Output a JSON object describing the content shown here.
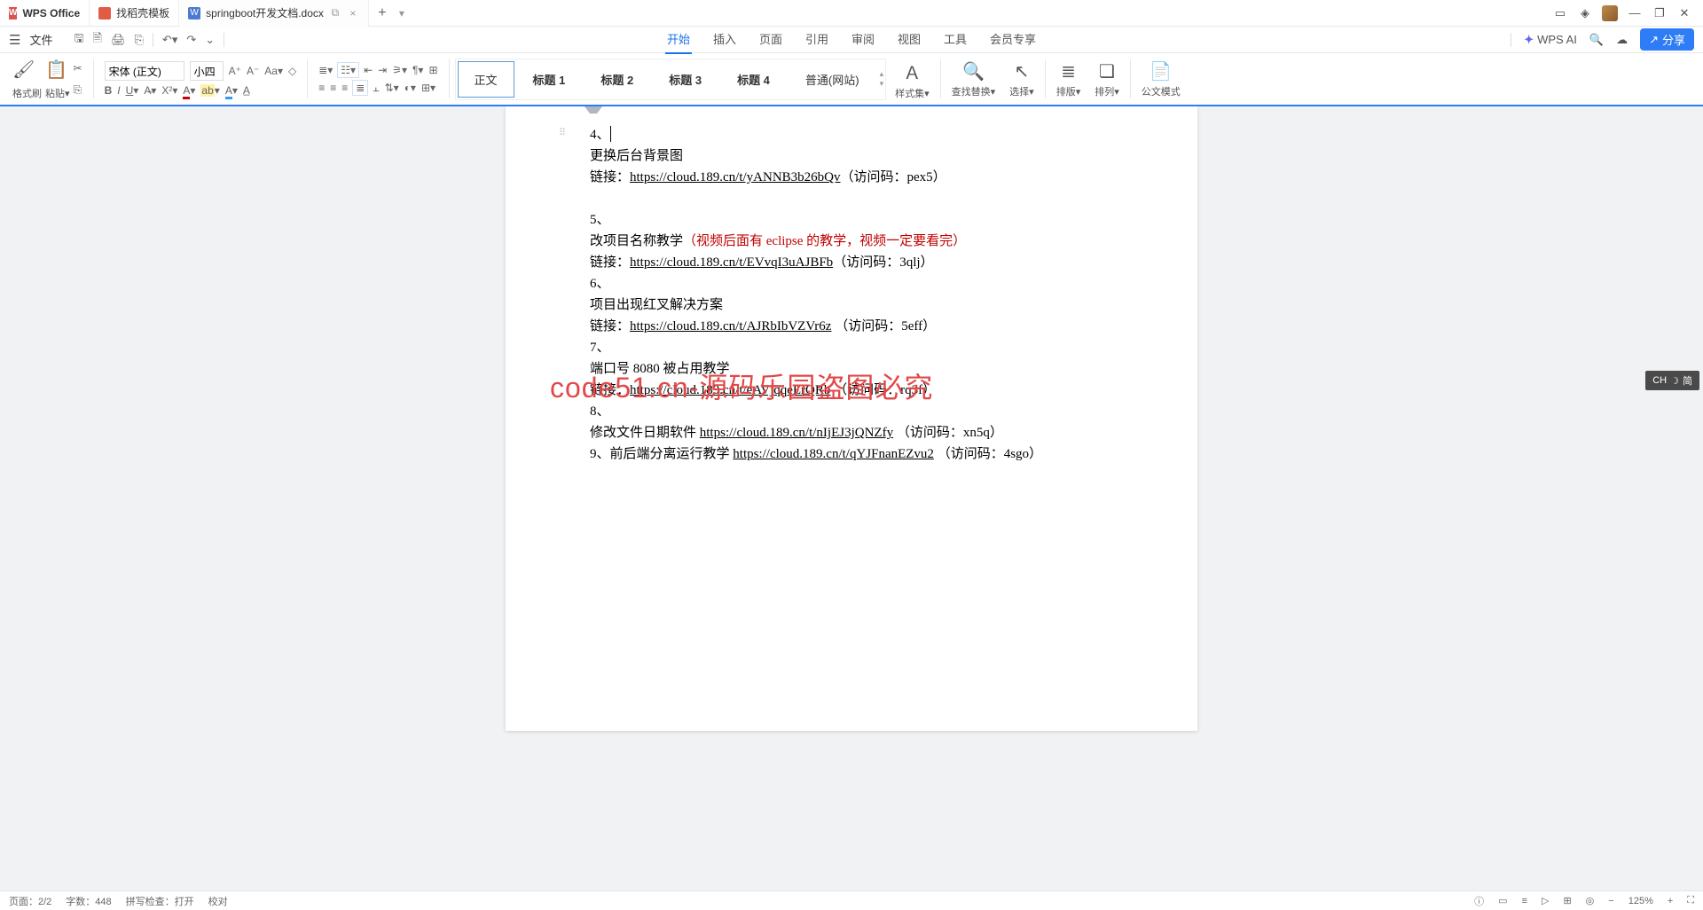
{
  "tabs": {
    "app": "WPS Office",
    "t1": "找稻壳模板",
    "t2": "springboot开发文档.docx"
  },
  "menubar": {
    "file": "文件",
    "items": [
      "开始",
      "插入",
      "页面",
      "引用",
      "审阅",
      "视图",
      "工具",
      "会员专享"
    ],
    "activeIndex": 0,
    "wps_ai": "WPS AI",
    "share": "分享"
  },
  "ribbon": {
    "format_painter": "格式刷",
    "paste": "粘贴",
    "font": "宋体 (正文)",
    "size": "小四",
    "styles": {
      "body": "正文",
      "h1": "标题 1",
      "h2": "标题 2",
      "h3": "标题 3",
      "h4": "标题 4",
      "normal_site": "普通(网站)"
    },
    "style_set": "样式集",
    "find_replace": "查找替换",
    "select": "选择",
    "arrange": "排版",
    "sort": "排列",
    "gov_mode": "公文模式"
  },
  "document": {
    "l4_num": "4、",
    "l4_title": "更换后台背景图",
    "l4_link_label": "链接：",
    "l4_url": "https://cloud.189.cn/t/yANNB3b26bQv",
    "l4_code": "（访问码：pex5）",
    "l5_num": "5、",
    "l5_title_a": "改项目名称教学",
    "l5_title_b": "（视频后面有 eclipse 的教学，视频一定要看完）",
    "l5_link_label": "链接：",
    "l5_url": "https://cloud.189.cn/t/EVvqI3uAJBFb",
    "l5_code": "（访问码：3qlj）",
    "l6_num": "6、",
    "l6_title": "项目出现红叉解决方案",
    "l6_link_label": "链接：",
    "l6_url": "https://cloud.189.cn/t/AJRbIbVZVr6z",
    "l6_code": " （访问码：5eff）",
    "l7_num": "7、",
    "l7_title": "端口号 8080 被占用教学",
    "l7_link_label": "链接：",
    "l7_url": "https://cloud.189.cn/t/eAVjqqeErQRb",
    "l7_code": " （访问码：rq3f）",
    "l8_num": "8、",
    "l8_title": "修改文件日期软件 ",
    "l8_url": "https://cloud.189.cn/t/nIjEJ3jQNZfy",
    "l8_code": " （访问码：xn5q）",
    "l9_num": "9、",
    "l9_title": "前后端分离运行教学 ",
    "l9_url": "https://cloud.189.cn/t/qYJFnanEZvu2",
    "l9_code": " （访问码：4sgo）",
    "watermark": "code51.cn-源码乐园盗图必究"
  },
  "status": {
    "page": "页面：2/2",
    "words": "字数：448",
    "spell": "拼写检查：打开",
    "proof": "校对",
    "zoom": "125%"
  },
  "ime": {
    "lang": "CH",
    "mode": "简"
  }
}
